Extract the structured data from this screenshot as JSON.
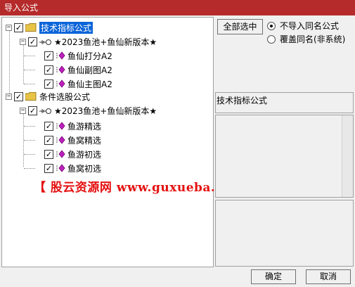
{
  "window": {
    "title": "导入公式"
  },
  "tree": {
    "groups": [
      {
        "label": "技术指标公式",
        "checked": true,
        "selected": true,
        "version": "★2023鱼池+鱼仙新版本★",
        "items": [
          "鱼仙打分A2",
          "鱼仙副图A2",
          "鱼仙主图A2"
        ]
      },
      {
        "label": "条件选股公式",
        "checked": true,
        "selected": false,
        "version": "★2023鱼池+鱼仙新版本★",
        "items": [
          "鱼游精选",
          "鱼窝精选",
          "鱼游初选",
          "鱼窝初选"
        ]
      }
    ],
    "expander_symbol": "−",
    "check_symbol": "✓"
  },
  "options": {
    "select_all_label": "全部选中",
    "radio_no_import": "不导入同名公式",
    "radio_overwrite": "覆盖同名(非系统)",
    "selected_radio": "no_import"
  },
  "info": {
    "category_label": "技术指标公式"
  },
  "watermark": {
    "text": "【 股云资源网 www.guxueba.cn 】"
  },
  "footer": {
    "ok_label": "确定",
    "cancel_label": "取消"
  },
  "colors": {
    "titlebar": "#b52a2a",
    "selection": "#0a64d8",
    "folder": "#e8c446",
    "formula_icon": "#c020c0",
    "watermark": "#e51010"
  }
}
